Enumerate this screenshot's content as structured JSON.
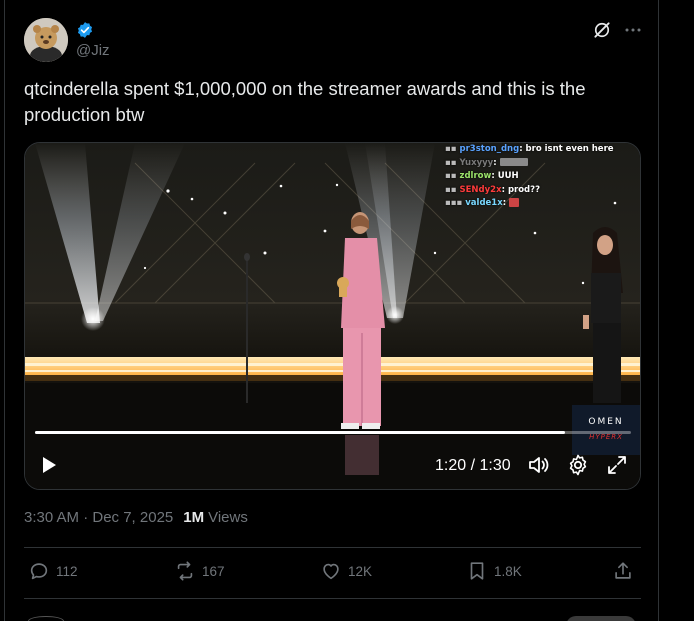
{
  "post": {
    "handle": "@Jiz",
    "text": "qtcinderella spent $1,000,000 on the streamer awards and this is the production btw",
    "timestamp": "3:30 AM · Dec 7, 2025",
    "views_count": "1M",
    "views_label": "Views",
    "verified_color": "#1d9bf0"
  },
  "video": {
    "time_display": "1:20 / 1:30",
    "progress": 0.89,
    "chat": [
      {
        "user": "pr3ston_dng",
        "message": "bro isnt even here",
        "color": "#5aa3ff"
      },
      {
        "user": "Yuxyyy",
        "message": "",
        "color": "#7a7a7a"
      },
      {
        "user": "zdlrow",
        "message": "UUH",
        "color": "#9be36a"
      },
      {
        "user": "SENdy2x",
        "message": "prod??",
        "color": "#ff3b3b"
      },
      {
        "user": "valde1x",
        "message": "",
        "color": "#79d8ff"
      }
    ],
    "sponsor_primary": "OMEN",
    "sponsor_secondary": "HYPERX"
  },
  "actions": {
    "replies": "112",
    "reposts": "167",
    "likes": "12K",
    "bookmarks": "1.8K"
  },
  "icons": [
    "verified-badge-icon",
    "grok-icon",
    "more-icon",
    "play-icon",
    "volume-icon",
    "settings-icon",
    "fullscreen-icon",
    "reply-icon",
    "repost-icon",
    "like-icon",
    "bookmark-icon",
    "share-icon"
  ]
}
